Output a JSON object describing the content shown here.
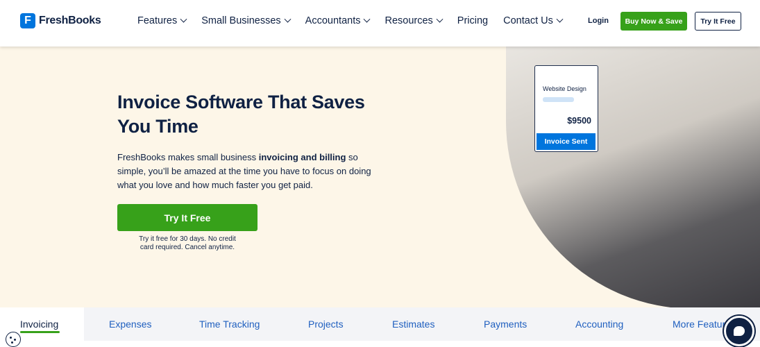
{
  "brand": {
    "name": "FreshBooks",
    "logo_letter": "F",
    "accent": "#37a11a",
    "primary": "#0075dd",
    "navy": "#0f2143"
  },
  "nav": {
    "items": [
      {
        "label": "Features",
        "has_dropdown": true
      },
      {
        "label": "Small Businesses",
        "has_dropdown": true
      },
      {
        "label": "Accountants",
        "has_dropdown": true
      },
      {
        "label": "Resources",
        "has_dropdown": true
      },
      {
        "label": "Pricing",
        "has_dropdown": false
      },
      {
        "label": "Contact Us",
        "has_dropdown": true
      }
    ],
    "login": "Login",
    "buy": "Buy Now & Save",
    "try": "Try It Free"
  },
  "hero": {
    "title": "Invoice Software That Saves You Time",
    "desc_pre": "FreshBooks makes small business ",
    "desc_bold": "invoicing and billing",
    "desc_post": " so simple, you’ll be amazed at the time you have to focus on doing what you love and how much faster you get paid.",
    "cta": "Try It Free",
    "note": "Try it free for 30 days. No credit card required. Cancel anytime."
  },
  "invoice_card": {
    "title": "Website Design",
    "amount": "$9500",
    "status": "Invoice Sent"
  },
  "tabs": {
    "active": "Invoicing",
    "items": [
      "Expenses",
      "Time Tracking",
      "Projects",
      "Estimates",
      "Payments",
      "Accounting",
      "More Features"
    ]
  },
  "icons": {
    "cookie": "cookie-icon",
    "chat": "chat-icon"
  }
}
